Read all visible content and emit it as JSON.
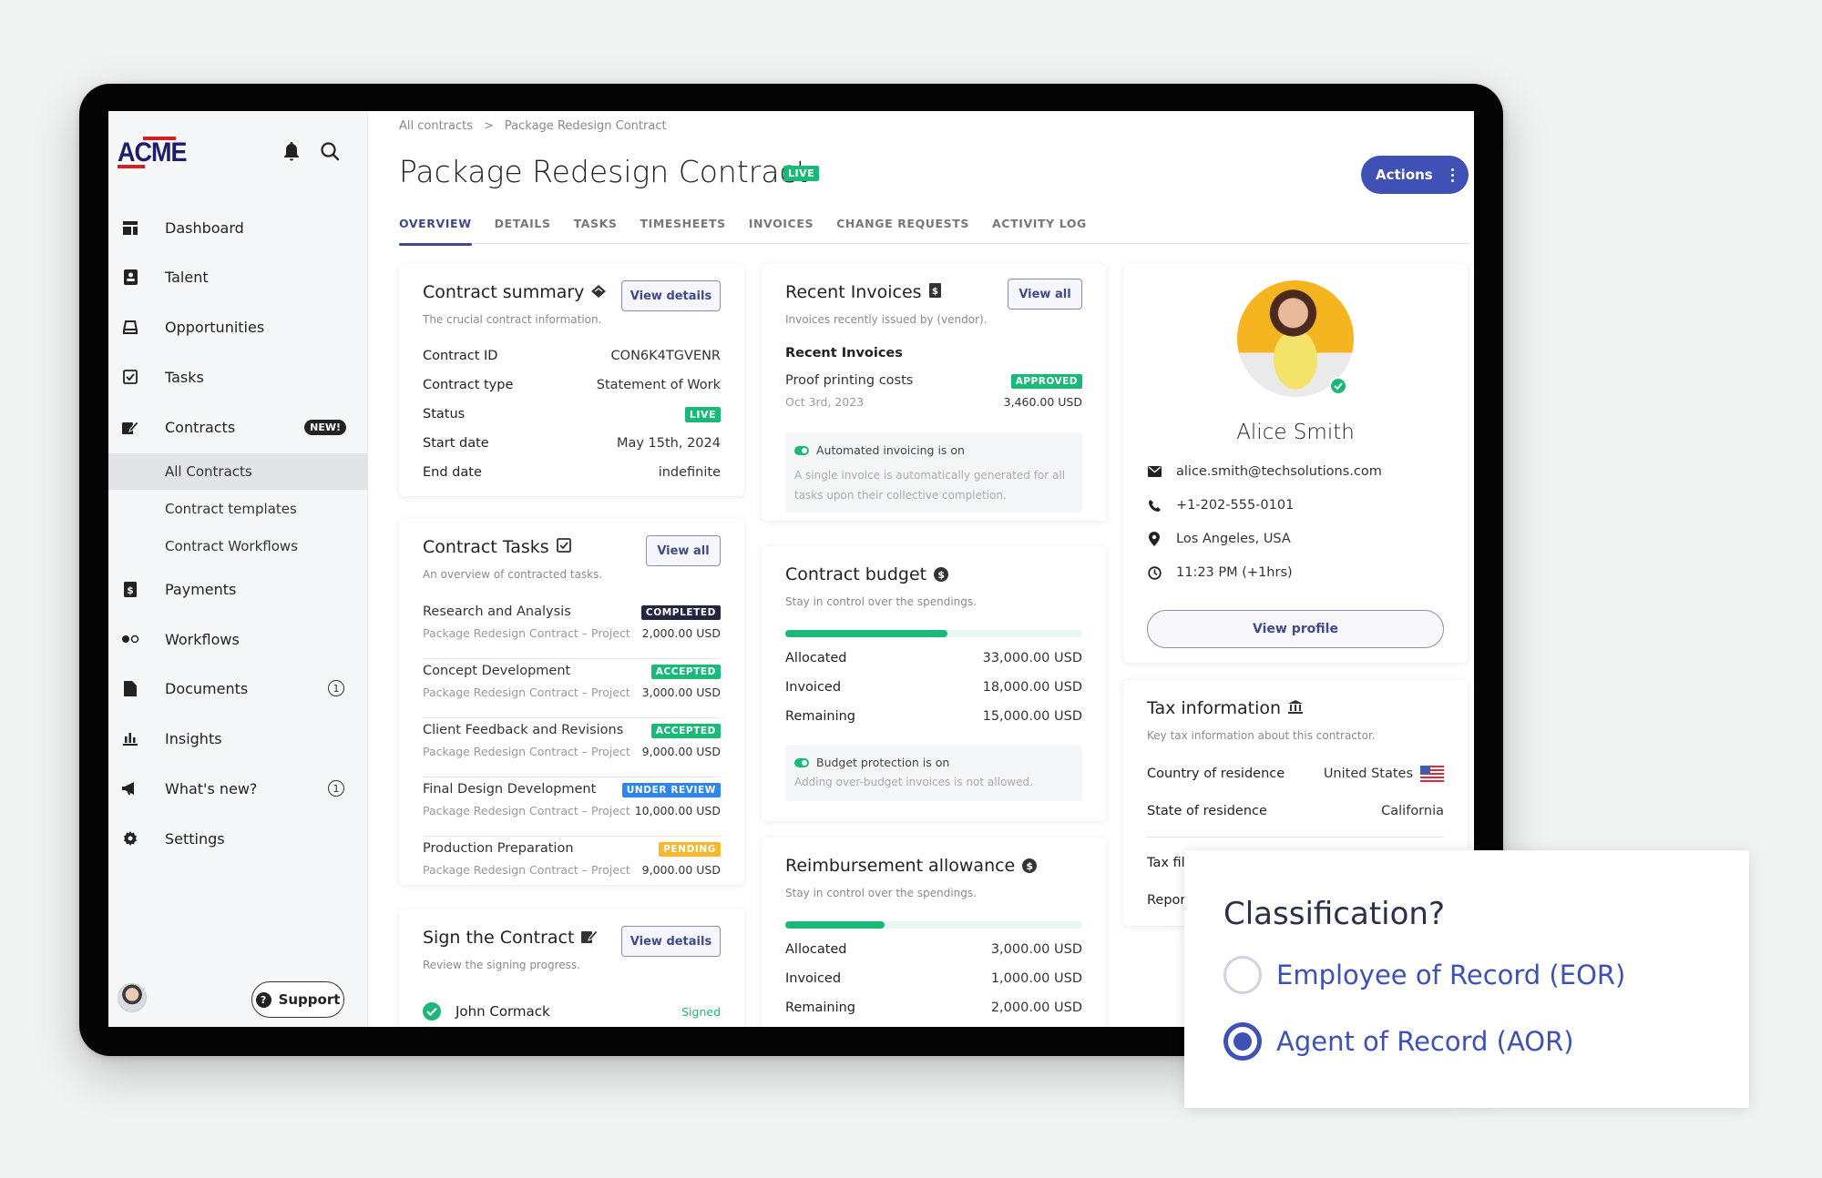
{
  "sidebar": {
    "logo": "ACME",
    "nav": [
      {
        "label": "Dashboard",
        "icon": "dashboard-icon"
      },
      {
        "label": "Talent",
        "icon": "contact-card-icon"
      },
      {
        "label": "Opportunities",
        "icon": "bell-outline-icon"
      },
      {
        "label": "Tasks",
        "icon": "checkbox-icon"
      },
      {
        "label": "Contracts",
        "icon": "contract-sign-icon",
        "badge": "NEW!"
      },
      {
        "label": "Payments",
        "icon": "dollar-doc-icon"
      },
      {
        "label": "Workflows",
        "icon": "workflow-icon"
      },
      {
        "label": "Documents",
        "icon": "document-icon",
        "count": "1"
      },
      {
        "label": "Insights",
        "icon": "bar-chart-icon"
      },
      {
        "label": "What's new?",
        "icon": "megaphone-icon",
        "count": "1"
      },
      {
        "label": "Settings",
        "icon": "gear-icon"
      }
    ],
    "contracts_sub": [
      {
        "label": "All Contracts",
        "active": true
      },
      {
        "label": "Contract templates"
      },
      {
        "label": "Contract Workflows"
      }
    ],
    "support_label": "Support"
  },
  "header": {
    "breadcrumb": [
      "All contracts",
      "Package Redesign Contract"
    ],
    "breadcrumb_sep": ">",
    "title": "Package Redesign Contract",
    "status": "LIVE",
    "actions_label": "Actions",
    "tabs": [
      "OVERVIEW",
      "DETAILS",
      "TASKS",
      "TIMESHEETS",
      "INVOICES",
      "CHANGE REQUESTS",
      "ACTIVITY LOG"
    ],
    "active_tab": "OVERVIEW"
  },
  "summary": {
    "title": "Contract summary",
    "subtitle": "The crucial contract information.",
    "button": "View details",
    "rows": [
      {
        "k": "Contract ID",
        "v": "CON6K4TGVENR"
      },
      {
        "k": "Contract type",
        "v": "Statement of Work"
      },
      {
        "k": "Status",
        "v": "LIVE"
      },
      {
        "k": "Start date",
        "v": "May 15th, 2024"
      },
      {
        "k": "End date",
        "v": "indefinite"
      }
    ]
  },
  "tasks": {
    "title": "Contract Tasks",
    "subtitle": "An overview of contracted tasks.",
    "button": "View all",
    "items": [
      {
        "name": "Research and Analysis",
        "project": "Package Redesign Contract – Project",
        "status": "COMPLETED",
        "color": "#23263f",
        "amount": "2,000.00 USD"
      },
      {
        "name": "Concept Development",
        "project": "Package Redesign Contract – Project",
        "status": "ACCEPTED",
        "color": "#1bb978",
        "amount": "3,000.00 USD"
      },
      {
        "name": "Client Feedback and Revisions",
        "project": "Package Redesign Contract – Project",
        "status": "ACCEPTED",
        "color": "#1bb978",
        "amount": "9,000.00 USD"
      },
      {
        "name": "Final Design Development",
        "project": "Package Redesign Contract – Project",
        "status": "UNDER REVIEW",
        "color": "#2f86e8",
        "amount": "10,000.00 USD"
      },
      {
        "name": "Production Preparation",
        "project": "Package Redesign Contract – Project",
        "status": "PENDING",
        "color": "#f5b82e",
        "amount": "9,000.00 USD"
      }
    ]
  },
  "sign": {
    "title": "Sign the Contract",
    "subtitle": "Review the signing progress.",
    "button": "View details",
    "signer": "John Cormack",
    "signer_status": "Signed"
  },
  "invoices": {
    "title": "Recent Invoices",
    "subtitle": "Invoices recently issued by (vendor).",
    "button": "View all",
    "section": "Recent Invoices",
    "item": {
      "name": "Proof printing costs",
      "date": "Oct 3rd, 2023",
      "status": "APPROVED",
      "amount": "3,460.00 USD"
    },
    "auto_title": "Automated invoicing is on",
    "auto_desc": "A single invoice is automatically generated for all tasks upon their collective completion."
  },
  "budget": {
    "title": "Contract budget",
    "subtitle": "Stay in control over the spendings.",
    "progress_fraction": 0.545,
    "rows": [
      {
        "k": "Allocated",
        "v": "33,000.00 USD"
      },
      {
        "k": "Invoiced",
        "v": "18,000.00 USD"
      },
      {
        "k": "Remaining",
        "v": "15,000.00 USD"
      }
    ],
    "protect_title": "Budget protection is on",
    "protect_desc": "Adding over-budget invoices is not allowed."
  },
  "reimburse": {
    "title": "Reimbursement allowance",
    "subtitle": "Stay in control over the spendings.",
    "progress_fraction": 0.333,
    "rows": [
      {
        "k": "Allocated",
        "v": "3,000.00 USD"
      },
      {
        "k": "Invoiced",
        "v": "1,000.00 USD"
      },
      {
        "k": "Remaining",
        "v": "2,000.00 USD"
      }
    ]
  },
  "profile": {
    "name": "Alice Smith",
    "email": "alice.smith@techsolutions.com",
    "phone": "+1-202-555-0101",
    "location": "Los Angeles, USA",
    "time": "11:23 PM (+1hrs)",
    "button": "View profile"
  },
  "tax": {
    "title": "Tax information",
    "subtitle": "Key tax information about this contractor.",
    "rows": [
      {
        "k": "Country of residence",
        "v": "United States"
      },
      {
        "k": "State of residence",
        "v": "California"
      }
    ],
    "partial_rows": [
      "Tax fil",
      "Repor"
    ]
  },
  "classification": {
    "question": "Classification?",
    "options": [
      {
        "label": "Employee of Record (EOR)",
        "selected": false
      },
      {
        "label": "Agent of Record (AOR)",
        "selected": true
      }
    ]
  },
  "colors": {
    "accent": "#3f51b5",
    "success": "#1bb978",
    "logo_navy": "#1d1e6b",
    "logo_red": "#d81f26"
  }
}
